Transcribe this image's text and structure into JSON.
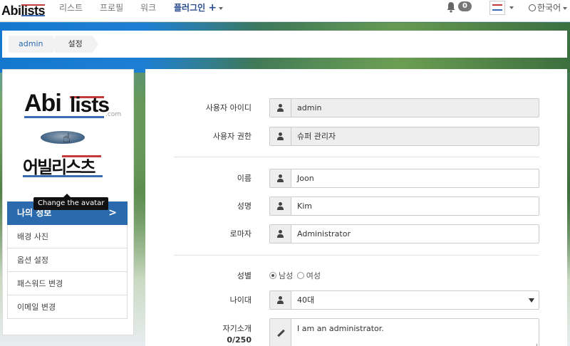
{
  "navbar": {
    "brand_abi": "Abi",
    "brand_lists": "lists",
    "links": [
      "리스트",
      "프로필",
      "워크"
    ],
    "plugin_label": "플러그인",
    "plugin_plus": "+",
    "notification_count": "0",
    "language": "한국어"
  },
  "breadcrumb": {
    "items": [
      "admin",
      "설정"
    ]
  },
  "left_panel": {
    "logo_word1": "Abi",
    "logo_word2": "lists",
    "logo_com": ".com",
    "logo_korean": "어빌리스츠",
    "tooltip": "Change the avatar",
    "menu": [
      {
        "label": "나의 정보",
        "active": true
      },
      {
        "label": "배경 사진",
        "active": false
      },
      {
        "label": "옵션 설정",
        "active": false
      },
      {
        "label": "패스워드 변경",
        "active": false
      },
      {
        "label": "이메일 변경",
        "active": false
      }
    ]
  },
  "form": {
    "user_id_label": "사용자 아이디",
    "user_id_value": "admin",
    "role_label": "사용자 권한",
    "role_value": "슈퍼 관리자",
    "first_name_label": "이름",
    "first_name_value": "Joon",
    "last_name_label": "성명",
    "last_name_value": "Kim",
    "romaja_label": "로마자",
    "romaja_value": "Administrator",
    "gender_label": "성별",
    "gender_male": "남성",
    "gender_female": "여성",
    "gender_selected": "male",
    "age_label": "나이대",
    "age_value": "40대",
    "bio_label": "자기소개",
    "bio_counter": "0/250",
    "bio_value": "I am an administrator."
  }
}
